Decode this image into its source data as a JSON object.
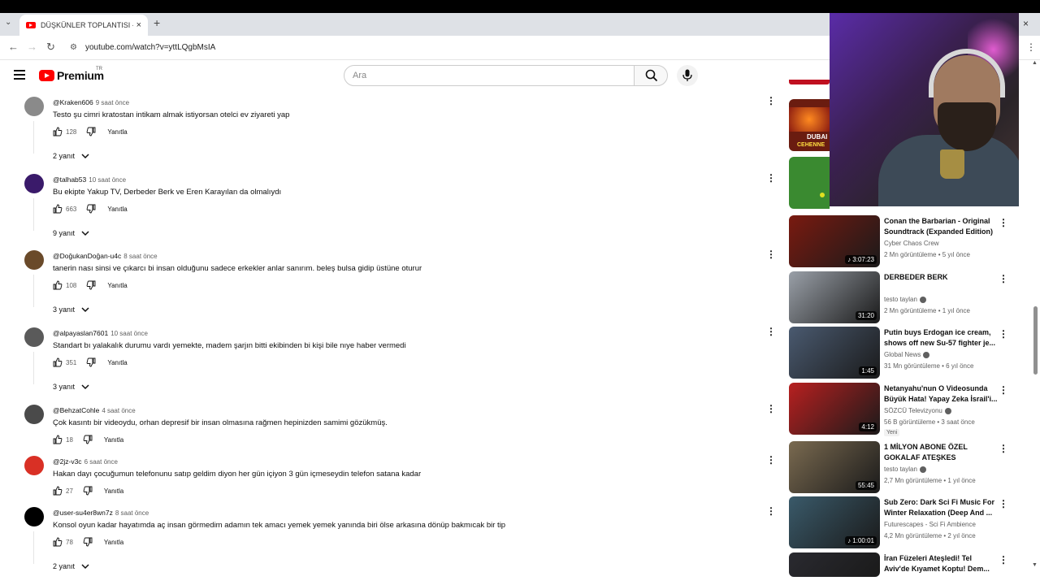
{
  "browser": {
    "tab_title": "DÜŞKÜNLER TOPLANTISI - You",
    "url": "youtube.com/watch?v=yttLQgbMsIA",
    "new_tab_label": "+",
    "close_label": "×"
  },
  "youtube": {
    "logo_text": "Premium",
    "region": "TR",
    "search_placeholder": "Ara"
  },
  "comments": [
    {
      "author": "@Kraken606",
      "time": "9 saat önce",
      "text": "Testo şu cimri kratostan intikam almak istiyorsan otelci ev ziyareti yap",
      "likes": "128",
      "reply_label": "Yanıtla",
      "replies": "2 yanıt",
      "avatar_color": "#8a8a8a"
    },
    {
      "author": "@talhab53",
      "time": "10 saat önce",
      "text": "Bu ekipte Yakup TV, Derbeder Berk ve Eren Karayılan da olmalıydı",
      "likes": "663",
      "reply_label": "Yanıtla",
      "replies": "9 yanıt",
      "avatar_color": "#3a1a6a"
    },
    {
      "author": "@DoğukanDoğan-u4c",
      "time": "8 saat önce",
      "text": "tanerin nası sinsi ve çıkarcı bi insan olduğunu sadece erkekler anlar sanırım. beleş bulsa gidip üstüne oturur",
      "likes": "108",
      "reply_label": "Yanıtla",
      "replies": "3 yanıt",
      "avatar_color": "#6a4a2a"
    },
    {
      "author": "@alpayaslan7601",
      "time": "10 saat önce",
      "text": "Standart bı yalakalık durumu vardı yemekte, madem şarjın bitti ekibinden bi kişi bile nıye haber vermedi",
      "likes": "351",
      "reply_label": "Yanıtla",
      "replies": "3 yanıt",
      "avatar_color": "#5a5a5a"
    },
    {
      "author": "@BehzatCohle",
      "time": "4 saat önce",
      "text": "Çok kasıntı bir videoydu, orhan depresif bir insan olmasına rağmen hepinizden samimi gözükmüş.",
      "likes": "18",
      "reply_label": "Yanıtla",
      "replies": "",
      "avatar_color": "#4a4a4a"
    },
    {
      "author": "@2jz-v3c",
      "time": "6 saat önce",
      "text": "Hakan dayı çocuğumun telefonunu satıp geldim diyon her gün içiyon 3 gün içmeseydin telefon satana kadar",
      "likes": "27",
      "reply_label": "Yanıtla",
      "replies": "",
      "avatar_color": "#d93025"
    },
    {
      "author": "@user-su4er8wn7z",
      "time": "8 saat önce",
      "text": "Konsol oyun kadar hayatımda aç insan görmedim adamın tek amacı yemek yemek yanında biri ölse arkasına dönüp bakmıcak bir tip",
      "likes": "78",
      "reply_label": "Yanıtla",
      "replies": "2 yanıt",
      "avatar_color": "#000000"
    }
  ],
  "recommendations": [
    {
      "title": "Conan the Barbarian - Original Soundtrack (Expanded Edition)",
      "channel": "Cyber Chaos Crew",
      "stats": "2 Mn görüntüleme • 5 yıl önce",
      "duration": "♪ 3:07:23",
      "verified": false,
      "badge": "",
      "thumb_color": "#7a1a10"
    },
    {
      "title": "DERBEDER BERK",
      "channel": "testo taylan",
      "stats": "2 Mn görüntüleme • 1 yıl önce",
      "duration": "31:20",
      "verified": true,
      "badge": "",
      "thumb_color": "#9aa0a8"
    },
    {
      "title": "Putin buys Erdogan ice cream, shows off new Su-57 fighter je...",
      "channel": "Global News",
      "stats": "31 Mn görüntüleme • 6 yıl önce",
      "duration": "1:45",
      "verified": true,
      "badge": "",
      "thumb_color": "#4a5a70"
    },
    {
      "title": "Netanyahu'nun O Videosunda Büyük Hata! Yapay Zeka İsrail'i...",
      "channel": "SÖZCÜ Televizyonu",
      "stats": "56 B görüntüleme • 3 saat önce",
      "duration": "4:12",
      "verified": true,
      "badge": "Yeni",
      "thumb_color": "#b82020"
    },
    {
      "title": "1 MİLYON ABONE ÖZEL GOKALAF ATEŞKES",
      "channel": "testo taylan",
      "stats": "2,7 Mn görüntüleme • 1 yıl önce",
      "duration": "55:45",
      "verified": true,
      "badge": "",
      "thumb_color": "#7a6a50"
    },
    {
      "title": "Sub Zero: Dark Sci Fi Music For Winter Relaxation (Deep And ...",
      "channel": "Futurescapes - Sci Fi Ambience",
      "stats": "4,2 Mn görüntüleme • 2 yıl önce",
      "duration": "♪ 1:00:01",
      "verified": false,
      "badge": "",
      "thumb_color": "#3a5a6a"
    },
    {
      "title": "İran Füzeleri Ateşledi! Tel Aviv'de Kıyamet Koptu! Dem...",
      "channel": "",
      "stats": "",
      "duration": "",
      "verified": false,
      "badge": "",
      "thumb_color": "#2a2a30"
    }
  ],
  "partial_recs": {
    "label1": "DUBAI",
    "label2": "CEHENNE",
    "label3": "Yeni"
  }
}
